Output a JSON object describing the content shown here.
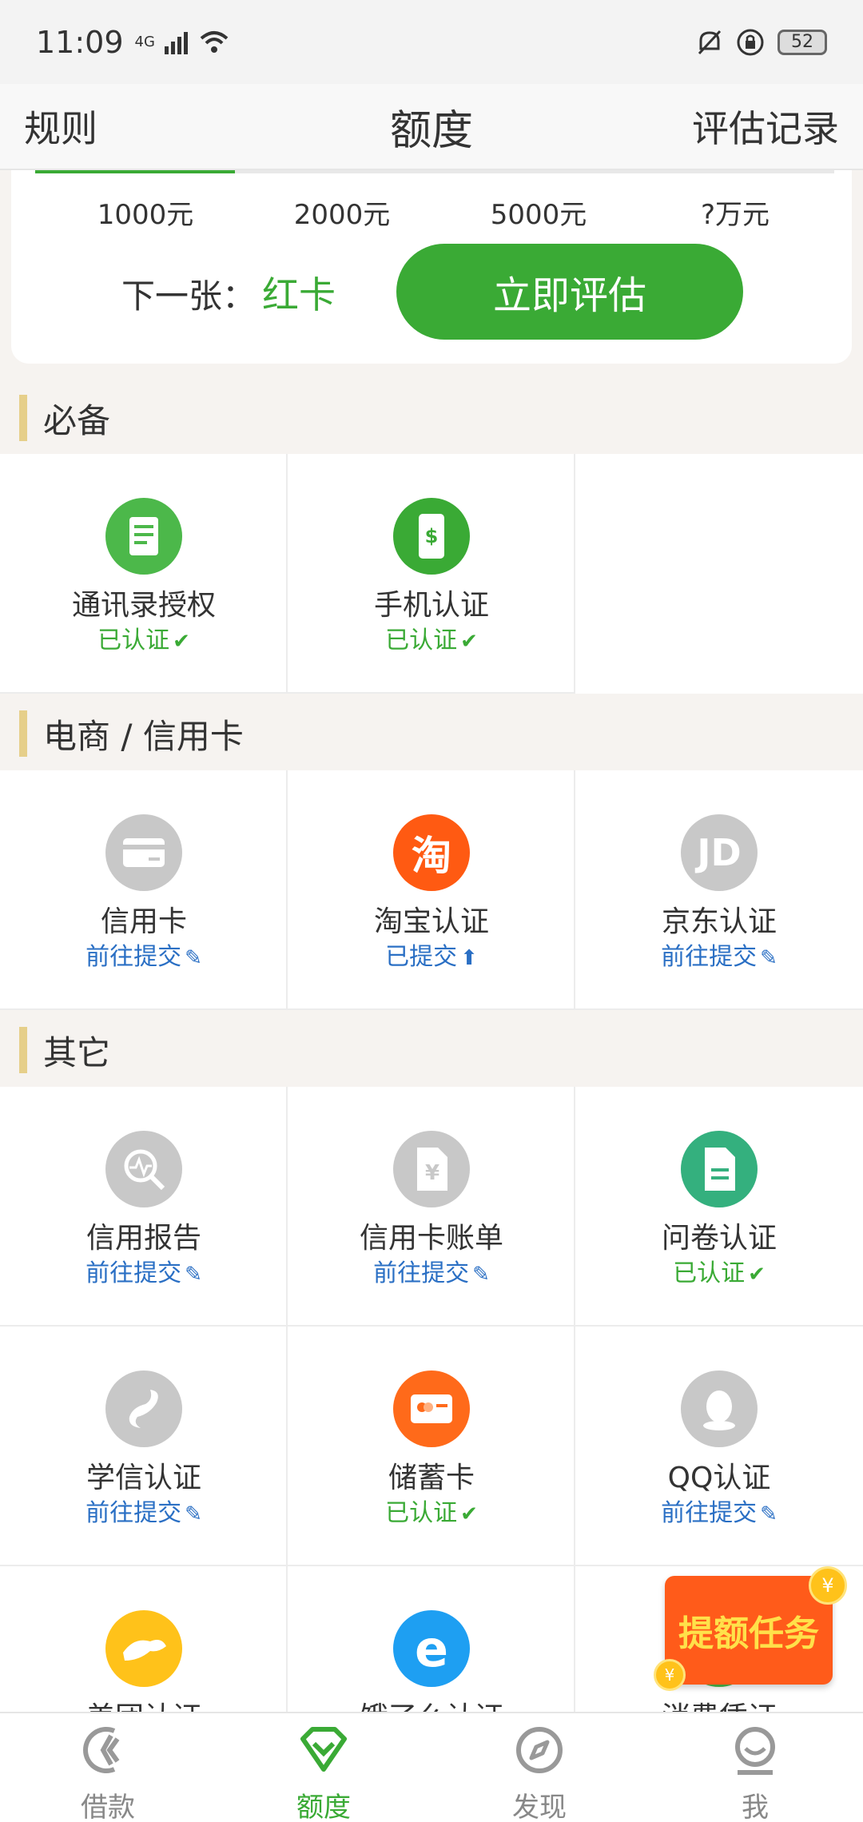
{
  "status_bar": {
    "time": "11:09",
    "network": "4G",
    "battery": "52"
  },
  "header": {
    "left": "规则",
    "title": "额度",
    "right": "评估记录"
  },
  "card": {
    "levels": [
      "1000元",
      "2000元",
      "5000元",
      "?万元"
    ],
    "progress_fraction": 0.25,
    "next_label": "下一张：",
    "next_card": "红卡",
    "evaluate_button": "立即评估"
  },
  "sections": {
    "required": {
      "title": "必备",
      "items": [
        {
          "name": "通讯录授权",
          "state": "已认证",
          "icon": "contacts-doc-icon",
          "color": "#4cb84a"
        },
        {
          "name": "手机认证",
          "state": "已认证",
          "icon": "phone-dollar-icon",
          "color": "#3aaa35"
        }
      ]
    },
    "ecommerce": {
      "title": "电商 / 信用卡",
      "items": [
        {
          "name": "信用卡",
          "state": "前往提交",
          "icon": "credit-card-icon",
          "color": "#c8c8c8"
        },
        {
          "name": "淘宝认证",
          "state": "已提交",
          "icon": "taobao-icon",
          "glyph": "淘",
          "color": "#ff5a12"
        },
        {
          "name": "京东认证",
          "state": "前往提交",
          "icon": "jd-icon",
          "glyph": "JD",
          "color": "#c8c8c8"
        }
      ]
    },
    "other": {
      "title": "其它",
      "row1": [
        {
          "name": "信用报告",
          "state": "前往提交",
          "icon": "report-search-icon",
          "color": "#c8c8c8"
        },
        {
          "name": "信用卡账单",
          "state": "前往提交",
          "icon": "bill-yuan-icon",
          "glyph": "¥",
          "color": "#c8c8c8"
        },
        {
          "name": "问卷认证",
          "state": "已认证",
          "icon": "questionnaire-icon",
          "color": "#34b07e"
        }
      ],
      "row2": [
        {
          "name": "学信认证",
          "state": "前往提交",
          "icon": "xuexin-icon",
          "color": "#c8c8c8"
        },
        {
          "name": "储蓄卡",
          "state": "已认证",
          "icon": "debit-card-icon",
          "color": "#ff6a1a"
        },
        {
          "name": "QQ认证",
          "state": "前往提交",
          "icon": "qq-icon",
          "color": "#c8c8c8"
        }
      ],
      "row3": [
        {
          "name": "美团认证",
          "icon": "meituan-icon",
          "color": "#ffc21a"
        },
        {
          "name": "饿了么认证",
          "icon": "eleme-icon",
          "glyph": "e",
          "color": "#1e9ff2"
        },
        {
          "name": "消费凭证",
          "icon": "receipt-icon",
          "color": "#4cb84a"
        }
      ]
    }
  },
  "promo": {
    "label": "提额任务",
    "coin": "¥"
  },
  "bottom_nav": [
    {
      "label": "借款",
      "icon": "loan-icon"
    },
    {
      "label": "额度",
      "icon": "quota-diamond-icon"
    },
    {
      "label": "发现",
      "icon": "compass-icon"
    },
    {
      "label": "我",
      "icon": "profile-icon"
    }
  ]
}
